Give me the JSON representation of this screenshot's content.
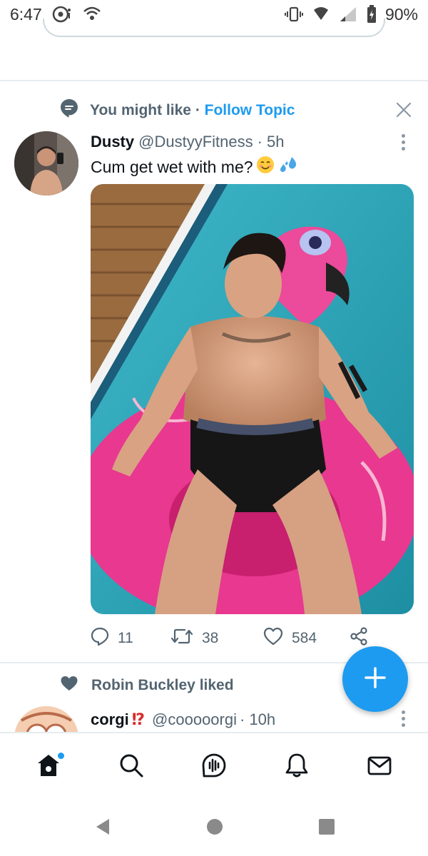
{
  "status_bar": {
    "time": "6:47",
    "battery": "90%",
    "icons": [
      "music-disc-icon",
      "hotspot-icon",
      "vibrate-icon",
      "wifi-icon",
      "signal-icon",
      "battery-icon"
    ]
  },
  "tweet1": {
    "context_label": "You might like",
    "separator": "·",
    "follow_topic": "Follow Topic",
    "author_name": "Dusty",
    "author_handle": "@DustyyFitness",
    "time": "· 5h",
    "text": "Cum get wet with me?",
    "emojis": [
      "smiling-face-emoji",
      "sweat-droplets-emoji"
    ],
    "media_alt": "Photo: shirtless man relaxing in a pink flamingo pool float",
    "replies": "11",
    "retweets": "38",
    "likes": "584"
  },
  "tweet2": {
    "social_context": "Robin Buckley liked",
    "author_name": "corgi",
    "author_emoji": "⁉",
    "author_handle": "@cooooorgi",
    "time": "· 10h"
  },
  "bottom_nav": [
    "home",
    "search",
    "spaces",
    "notifications",
    "messages"
  ],
  "colors": {
    "accent": "#1d9bf0",
    "text_primary": "#0f1419",
    "text_secondary": "#536471",
    "divider": "#e6ecf0"
  }
}
